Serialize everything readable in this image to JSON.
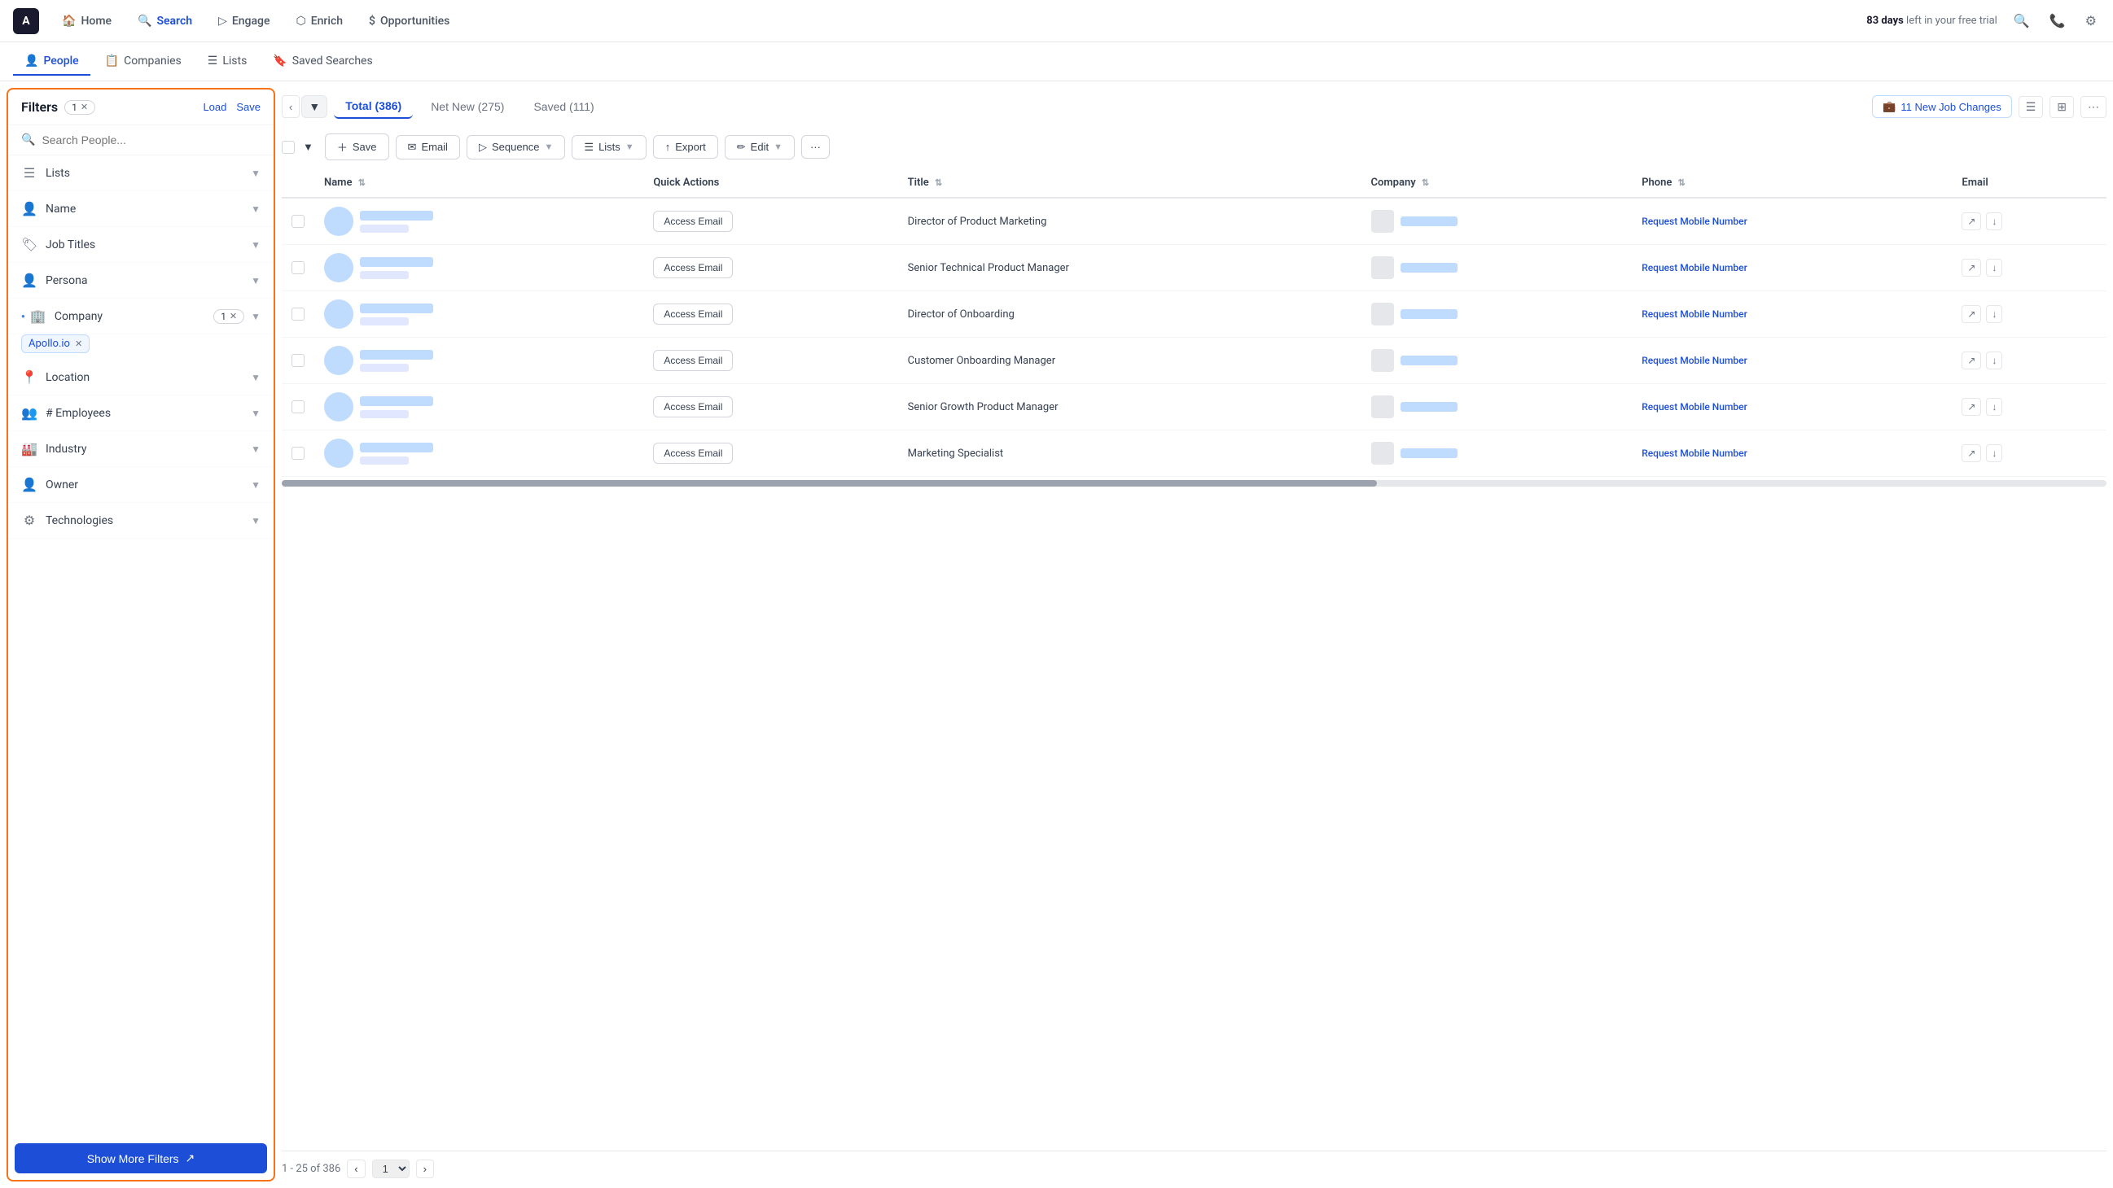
{
  "app": {
    "logo_text": "A",
    "trial_text": "83 days",
    "trial_suffix": " left in your free trial"
  },
  "top_nav": {
    "items": [
      {
        "id": "home",
        "label": "Home",
        "icon": "🏠",
        "active": false
      },
      {
        "id": "search",
        "label": "Search",
        "icon": "🔍",
        "active": true
      },
      {
        "id": "engage",
        "label": "Engage",
        "icon": "▷",
        "active": false
      },
      {
        "id": "enrich",
        "label": "Enrich",
        "icon": "⬡",
        "active": false
      },
      {
        "id": "opportunities",
        "label": "Opportunities",
        "icon": "$",
        "active": false
      }
    ]
  },
  "sub_nav": {
    "items": [
      {
        "id": "people",
        "label": "People",
        "icon": "👤",
        "active": true
      },
      {
        "id": "companies",
        "label": "Companies",
        "icon": "📋",
        "active": false
      },
      {
        "id": "lists",
        "label": "Lists",
        "icon": "☰",
        "active": false
      },
      {
        "id": "saved_searches",
        "label": "Saved Searches",
        "icon": "🔖",
        "active": false
      }
    ]
  },
  "filters": {
    "title": "Filters",
    "badge_count": "1",
    "load_label": "Load",
    "save_label": "Save",
    "search_placeholder": "Search People...",
    "company_tag": "Apollo.io",
    "show_more_label": "Show More Filters",
    "items": [
      {
        "id": "lists",
        "label": "Lists",
        "icon": "☰"
      },
      {
        "id": "name",
        "label": "Name",
        "icon": "👤"
      },
      {
        "id": "job_titles",
        "label": "Job Titles",
        "icon": "🏷"
      },
      {
        "id": "persona",
        "label": "Persona",
        "icon": "👤"
      },
      {
        "id": "company",
        "label": "Company",
        "icon": "🏢",
        "badge": "1"
      },
      {
        "id": "location",
        "label": "Location",
        "icon": "📍"
      },
      {
        "id": "employees",
        "label": "# Employees",
        "icon": "👥"
      },
      {
        "id": "industry",
        "label": "Industry",
        "icon": "🏭"
      },
      {
        "id": "owner",
        "label": "Owner",
        "icon": "👤"
      },
      {
        "id": "technologies",
        "label": "Technologies",
        "icon": "⚙"
      }
    ]
  },
  "filter_tabs": {
    "total_label": "Total (386)",
    "net_new_label": "Net New (275)",
    "saved_label": "Saved (111)",
    "active": "total"
  },
  "job_changes_label": "11 New Job Changes",
  "actions": {
    "save_label": "Save",
    "email_label": "Email",
    "sequence_label": "Sequence",
    "lists_label": "Lists",
    "export_label": "Export",
    "edit_label": "Edit"
  },
  "table": {
    "columns": [
      {
        "id": "name",
        "label": "Name"
      },
      {
        "id": "quick_actions",
        "label": "Quick Actions"
      },
      {
        "id": "title",
        "label": "Title"
      },
      {
        "id": "company",
        "label": "Company"
      },
      {
        "id": "phone",
        "label": "Phone"
      },
      {
        "id": "email",
        "label": "Email"
      }
    ],
    "rows": [
      {
        "id": 1,
        "title": "Director of Product Marketing",
        "access_email_label": "Access Email",
        "phone_label": "Request Mobile Number"
      },
      {
        "id": 2,
        "title": "Senior Technical Product Manager",
        "access_email_label": "Access Email",
        "phone_label": "Request Mobile Number"
      },
      {
        "id": 3,
        "title": "Director of Onboarding",
        "access_email_label": "Access Email",
        "phone_label": "Request Mobile Number"
      },
      {
        "id": 4,
        "title": "Customer Onboarding Manager",
        "access_email_label": "Access Email",
        "phone_label": "Request Mobile Number"
      },
      {
        "id": 5,
        "title": "Senior Growth Product Manager",
        "access_email_label": "Access Email",
        "phone_label": "Request Mobile Number"
      },
      {
        "id": 6,
        "title": "Marketing Specialist",
        "access_email_label": "Access Email",
        "phone_label": "Request Mobile Number"
      }
    ]
  },
  "pagination": {
    "range_text": "1 - 25 of 386",
    "current_page": "1"
  }
}
